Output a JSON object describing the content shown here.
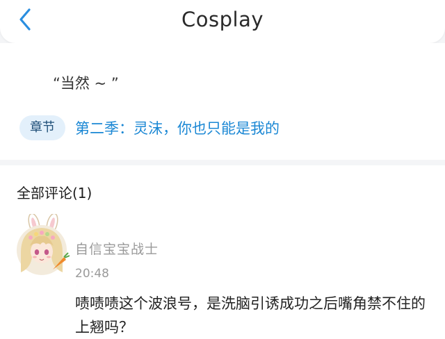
{
  "header": {
    "title": "Cosplay",
    "back_icon": "chevron-left-icon",
    "accent_color": "#2a8ee0"
  },
  "chapter": {
    "quote": "“当然 ~ ”",
    "tag_label": "章节",
    "title": "第二季：灵沫，你也只能是我的",
    "link_color": "#1a87d4"
  },
  "comments": {
    "header": "全部评论(1)",
    "items": [
      {
        "username": "自信宝宝战士",
        "time": "20:48",
        "text": "啧啧啧这个波浪号，是洗脑引诱成功之后嘴角禁不住的上翘吗？",
        "avatar_icon": "bunny-girl-avatar"
      }
    ]
  }
}
